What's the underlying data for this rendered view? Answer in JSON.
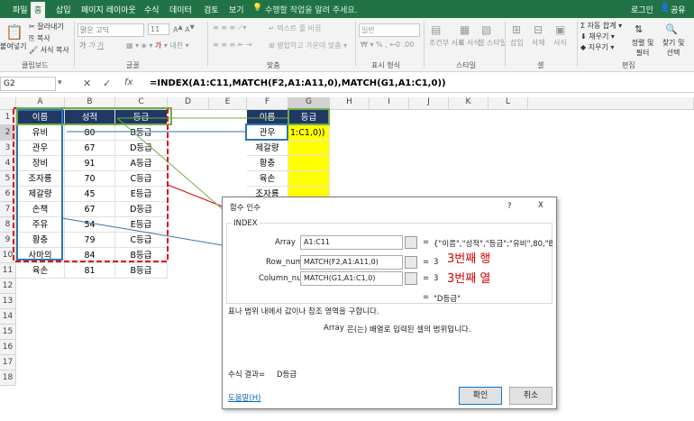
{
  "tabs": [
    "파일",
    "홈",
    "삽입",
    "페이지 레이아웃",
    "수식",
    "데이터",
    "검토",
    "보기"
  ],
  "tell_me": "수행할 작업을 알려 주세요.",
  "login": "로그인",
  "share": "공유",
  "ribbon": {
    "paste": "붙여넣기",
    "cut": "잘라내기",
    "copy": "복사",
    "format_painter": "서식 복사",
    "font_name": "맑은 고딕",
    "font_size": "11",
    "wrap": "텍스트 줄 바꿈",
    "merge": "병합하고 가운데 맞춤",
    "num_format": "일반",
    "cond": "조건부 서식",
    "table": "표 서식",
    "cell_style": "셀 스타일",
    "insert": "삽입",
    "delete": "삭제",
    "format": "서식",
    "autosum": "자동 합계",
    "fill": "채우기",
    "clear": "지우기",
    "sort": "정렬 및 필터",
    "find": "찾기 및 선택",
    "groups": [
      "클립보드",
      "글꼴",
      "맞춤",
      "표시 형식",
      "스타일",
      "셀",
      "편집"
    ]
  },
  "namebox": "G2",
  "formula": "=INDEX(A1:C11,MATCH(F2,A1:A11,0),MATCH(G1,A1:C1,0))",
  "columns": [
    "A",
    "B",
    "C",
    "D",
    "E",
    "F",
    "G",
    "H",
    "I",
    "J",
    "K",
    "L"
  ],
  "rows": [
    "1",
    "2",
    "3",
    "4",
    "5",
    "6",
    "7",
    "8",
    "9",
    "10",
    "11",
    "12",
    "13",
    "14",
    "15",
    "16",
    "17",
    "18"
  ],
  "table_header": [
    "이름",
    "성적",
    "등급"
  ],
  "table_rows": [
    [
      "유비",
      "80",
      "B등급"
    ],
    [
      "관우",
      "67",
      "D등급"
    ],
    [
      "장비",
      "91",
      "A등급"
    ],
    [
      "조자룡",
      "70",
      "C등급"
    ],
    [
      "제갈량",
      "45",
      "E등급"
    ],
    [
      "손책",
      "67",
      "D등급"
    ],
    [
      "주유",
      "54",
      "E등급"
    ],
    [
      "황충",
      "79",
      "C등급"
    ],
    [
      "사마의",
      "84",
      "B등급"
    ],
    [
      "육손",
      "81",
      "B등급"
    ]
  ],
  "lookup_header": [
    "이름",
    "등급"
  ],
  "lookup_rows": [
    [
      "관우",
      "1:C1,0))"
    ],
    [
      "제갈량",
      ""
    ],
    [
      "황충",
      ""
    ],
    [
      "육손",
      ""
    ],
    [
      "조자룡",
      ""
    ]
  ],
  "dialog": {
    "title": "함수 인수",
    "help_q": "?",
    "close": "X",
    "func": "INDEX",
    "array_label": "Array",
    "array_value": "A1:C11",
    "array_result": "{\"이름\",\"성적\",\"등급\";\"유비\",80,\"B등...",
    "row_label": "Row_num",
    "row_value": "MATCH(F2,A1:A11,0)",
    "row_result": "3",
    "col_label": "Column_num",
    "col_value": "MATCH(G1,A1:C1,0)",
    "col_result": "3",
    "eq": "=",
    "final_result": "\"D등급\"",
    "desc": "표나 범위 내에서 값이나 참조 영역을 구합니다.",
    "arg_desc_label": "Array",
    "arg_desc": "은(는) 배열로 입력된 셀의 범위입니다.",
    "result_label": "수식 결과=",
    "result_value": "D등급",
    "help_link": "도움말(H)",
    "ok": "확인",
    "cancel": "취소"
  },
  "annotations": {
    "row_anno": "3번째 행",
    "col_anno": "3번째 열"
  },
  "colors": {
    "excel_green": "#217346",
    "header_navy": "#1f3864",
    "highlight": "#ffff00",
    "red": "#e00000",
    "blue": "#2f75b5",
    "green": "#70ad47"
  }
}
